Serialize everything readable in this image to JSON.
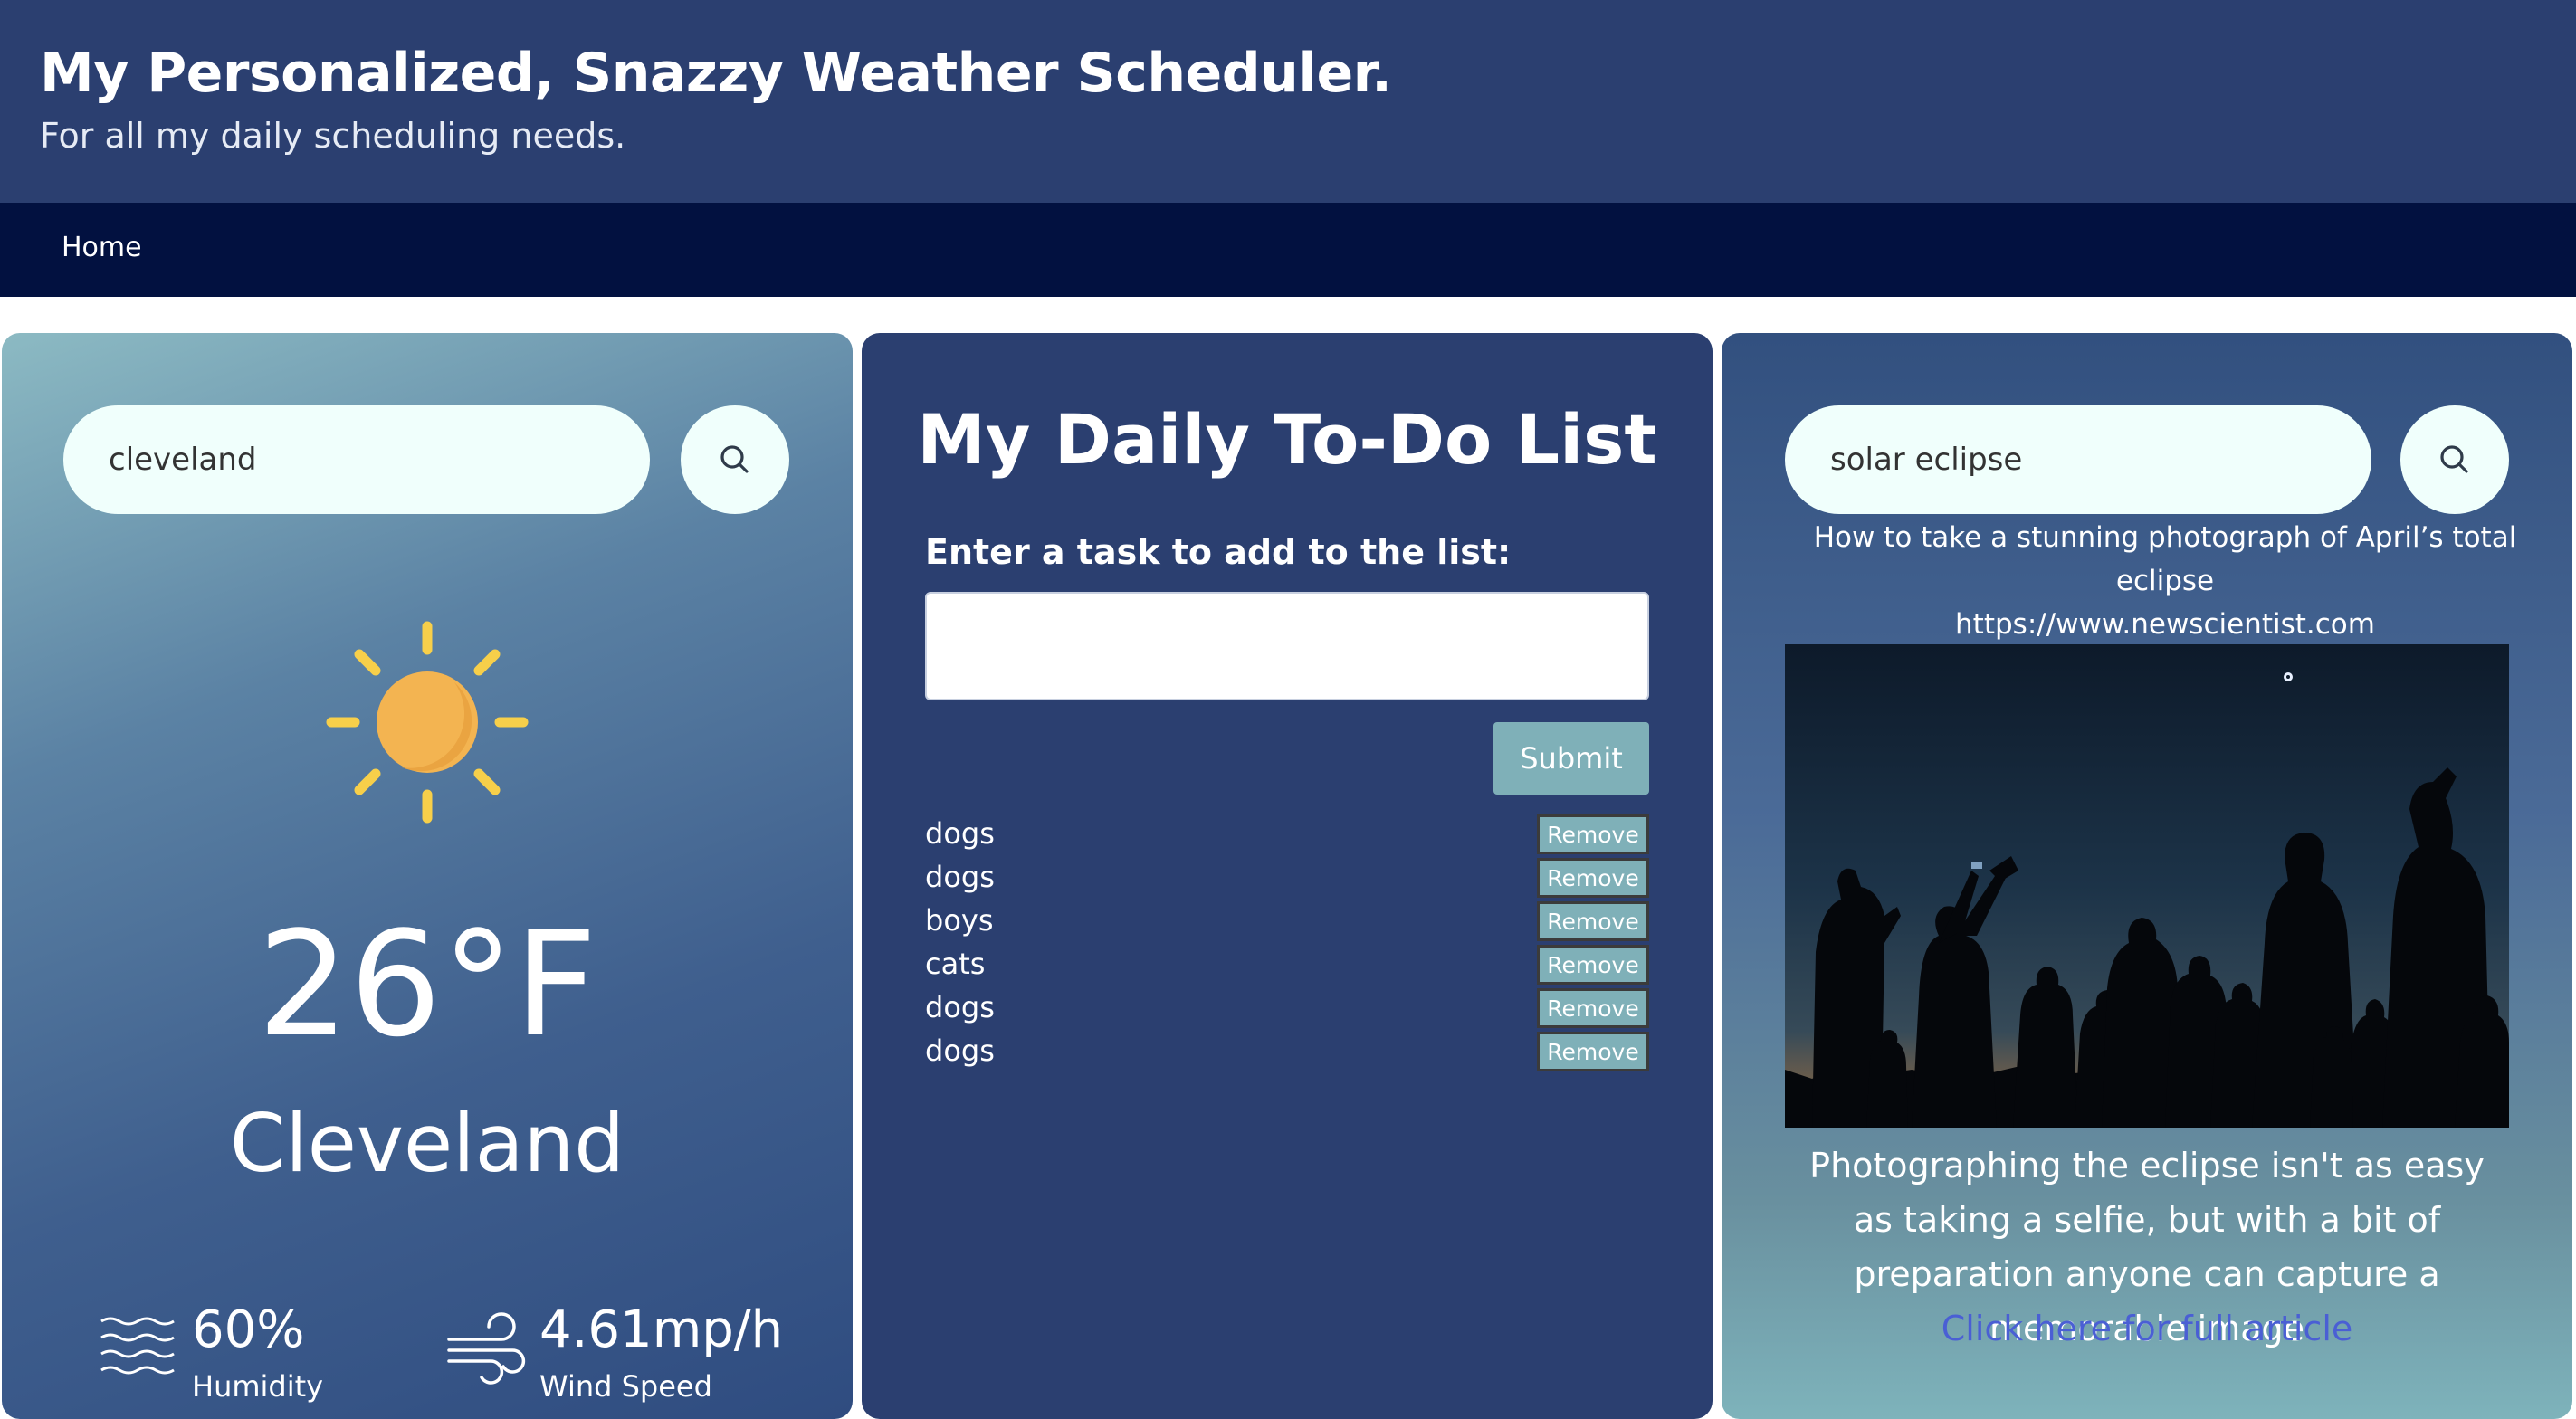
{
  "header": {
    "title": "My Personalized, Snazzy Weather Scheduler.",
    "subtitle": "For all my daily scheduling needs."
  },
  "nav": {
    "home": "Home"
  },
  "weather": {
    "search_value": "cleveland",
    "icon": "sun-icon",
    "temperature": "26°F",
    "city": "Cleveland",
    "humidity_value": "60%",
    "humidity_label": "Humidity",
    "wind_value": "4.61mp/h",
    "wind_label": "Wind Speed"
  },
  "todo": {
    "title": "My Daily To-Do List",
    "input_label": "Enter a task to add to the list:",
    "submit_label": "Submit",
    "remove_label": "Remove",
    "tasks": [
      "dogs",
      "dogs",
      "boys",
      "cats",
      "dogs",
      "dogs"
    ]
  },
  "news": {
    "search_value": "solar eclipse",
    "article_title": "How to take a stunning photograph of April’s total eclipse",
    "source_url": "https://www.newscientist.com",
    "description": "Photographing the eclipse isn't as easy as taking a selfie, but with a bit of preparation anyone can capture a memorable image",
    "link_text": "Click here for full article"
  },
  "colors": {
    "header_bg": "#2b3f70",
    "nav_bg": "#021140",
    "button_teal": "#7fb0b8",
    "link_blue": "#4a5fd4"
  }
}
